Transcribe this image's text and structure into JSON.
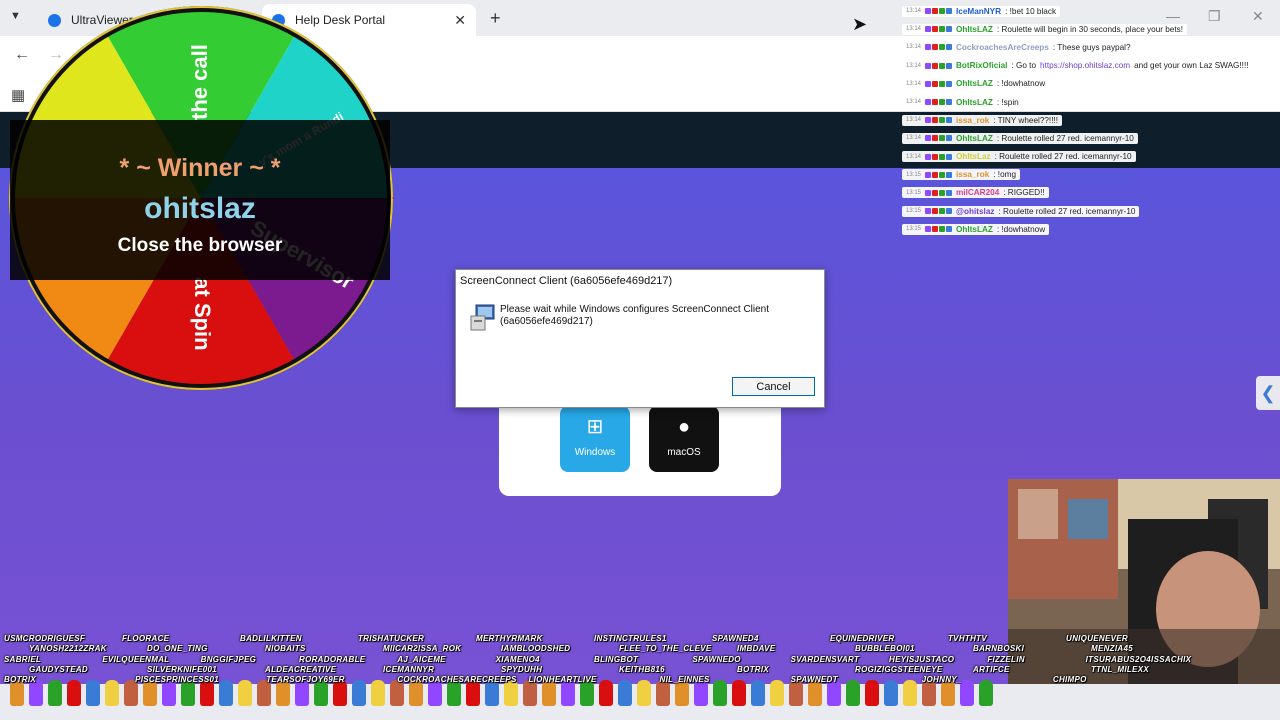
{
  "browser": {
    "tabs": [
      {
        "label": "UltraViewer"
      },
      {
        "label": "Help Desk Portal"
      }
    ],
    "new_tab": "+",
    "tab_close": "✕",
    "window_min": "—",
    "window_max": "❐",
    "window_close": "✕"
  },
  "page": {
    "os_buttons": [
      {
        "label": "Windows",
        "icon": "windows-icon"
      },
      {
        "label": "macOS",
        "icon": "apple-icon"
      }
    ]
  },
  "dialog": {
    "title": "ScreenConnect Client (6a6056efe469d217)",
    "message": "Please wait while Windows configures ScreenConnect Client (6a6056efe469d217)",
    "cancel_label": "Cancel"
  },
  "wheel": {
    "segments": [
      {
        "label": "at Spin",
        "color": "#d90f0f"
      },
      {
        "label": "Supervisor",
        "color": "#7c1a8f"
      },
      {
        "label": "y's mom a Rundi",
        "color": "#20d3c8"
      },
      {
        "label": "the call",
        "color": "#33cc33"
      },
      {
        "label": "",
        "color": "#dfe61b"
      },
      {
        "label": "",
        "color": "#f08a14"
      }
    ],
    "winner_label": "* ~ Winner ~ *",
    "winner_name": "ohitslaz",
    "winner_prize": "Close the browser"
  },
  "chat": [
    {
      "ts": "13:14",
      "user": "IceManNYR",
      "user_color": "#1f5cd6",
      "text": ": !bet 10 black"
    },
    {
      "ts": "13:14",
      "user": "OhItsLAZ",
      "user_color": "#2aa22a",
      "text": ": Roulette will begin in 30 seconds, place your bets!"
    },
    {
      "ts": "13:14",
      "user": "CockroachesAreCreeps",
      "user_color": "#8fa0c0",
      "text": ": These guys paypal?"
    },
    {
      "ts": "13:14",
      "user": "BotRixOficial",
      "user_color": "#2aa22a",
      "text": ": Go to ",
      "link": "https://shop.ohitslaz.com",
      "after": " and get your own Laz SWAG!!!!"
    },
    {
      "ts": "13:14",
      "user": "OhItsLAZ",
      "user_color": "#2aa22a",
      "text": ": !dowhatnow"
    },
    {
      "ts": "13:14",
      "user": "OhItsLAZ",
      "user_color": "#2aa22a",
      "text": ": !spin"
    },
    {
      "ts": "13:14",
      "user": "issa_rok",
      "user_color": "#e0902a",
      "text": ": TINY wheel??!!!!"
    },
    {
      "ts": "13:14",
      "user": "OhItsLAZ",
      "user_color": "#2aa22a",
      "text": ": Roulette rolled 27 red. icemannyr-10"
    },
    {
      "ts": "13:14",
      "user": "OhItsLaz",
      "user_color": "#cfd030",
      "text": ": Roulette rolled 27 red. icemannyr-10"
    },
    {
      "ts": "13:15",
      "user": "issa_rok",
      "user_color": "#e0902a",
      "text": ": !omg"
    },
    {
      "ts": "13:15",
      "user": "milCAR204",
      "user_color": "#e03a8a",
      "text": ": RIGGED!!"
    },
    {
      "ts": "13:15",
      "user": "@ohitslaz",
      "user_color": "#6d3fd6",
      "text": ": Roulette rolled 27 red. icemannyr-10"
    },
    {
      "ts": "13:15",
      "user": "OhItsLAZ",
      "user_color": "#2aa22a",
      "text": ": !dowhatnow"
    }
  ],
  "viewer_names": [
    [
      "USMCRODRIGUESF",
      "FLOORACE",
      "BADLILKITTEN",
      "TRISHATUCKER",
      "MERTHYRMARK",
      "INSTINCTRULES1",
      "SPAWNED4",
      "EQUINEDRIVER",
      "TVHTHTV",
      "UNIQUENEVER"
    ],
    [
      "YANOSH2212ZRAK",
      "DO_ONE_TING",
      "NIOBAITS",
      "MIICAR2ISSA_ROK",
      "IAMBLOODSHED",
      "FLEE_TO_THE_CLEVE",
      "IMBDAVE",
      "BUBBLEBOI01",
      "BARNBOSKI",
      "MENZIA45"
    ],
    [
      "SABRIEL",
      "EVILQUEENMAL",
      "BNGGIFJPEG",
      "RORADORABLE",
      "AJ_AICEME",
      "XIAMENO4",
      "BLINGBOT",
      "SPAWNEDO",
      "SVARDENSVART",
      "HEYISJUSTACO",
      "FIZZELIN",
      "ITSURABUS2O4ISSACHIX"
    ],
    [
      "GAUDYSTEAD",
      "SILVERKNIFE001",
      "ALDEACREATIVE",
      "ICEMANNYR",
      "SPYDUHH",
      "KEITHB816",
      "BOTRIX",
      "ROGIZIGGSTEENEYE",
      "ARTIFCE",
      "TTNL_MILEXX"
    ],
    [
      "BOTRIX",
      "PISCESPRINCESS01",
      "TEARSOFJOY69ER",
      "COCKROACHESARECREEPS",
      "LIONHEARTLIVE",
      "NIL_EINNES",
      "SPAWNEDT",
      "JOHNNY_",
      "CHIMPO"
    ]
  ]
}
